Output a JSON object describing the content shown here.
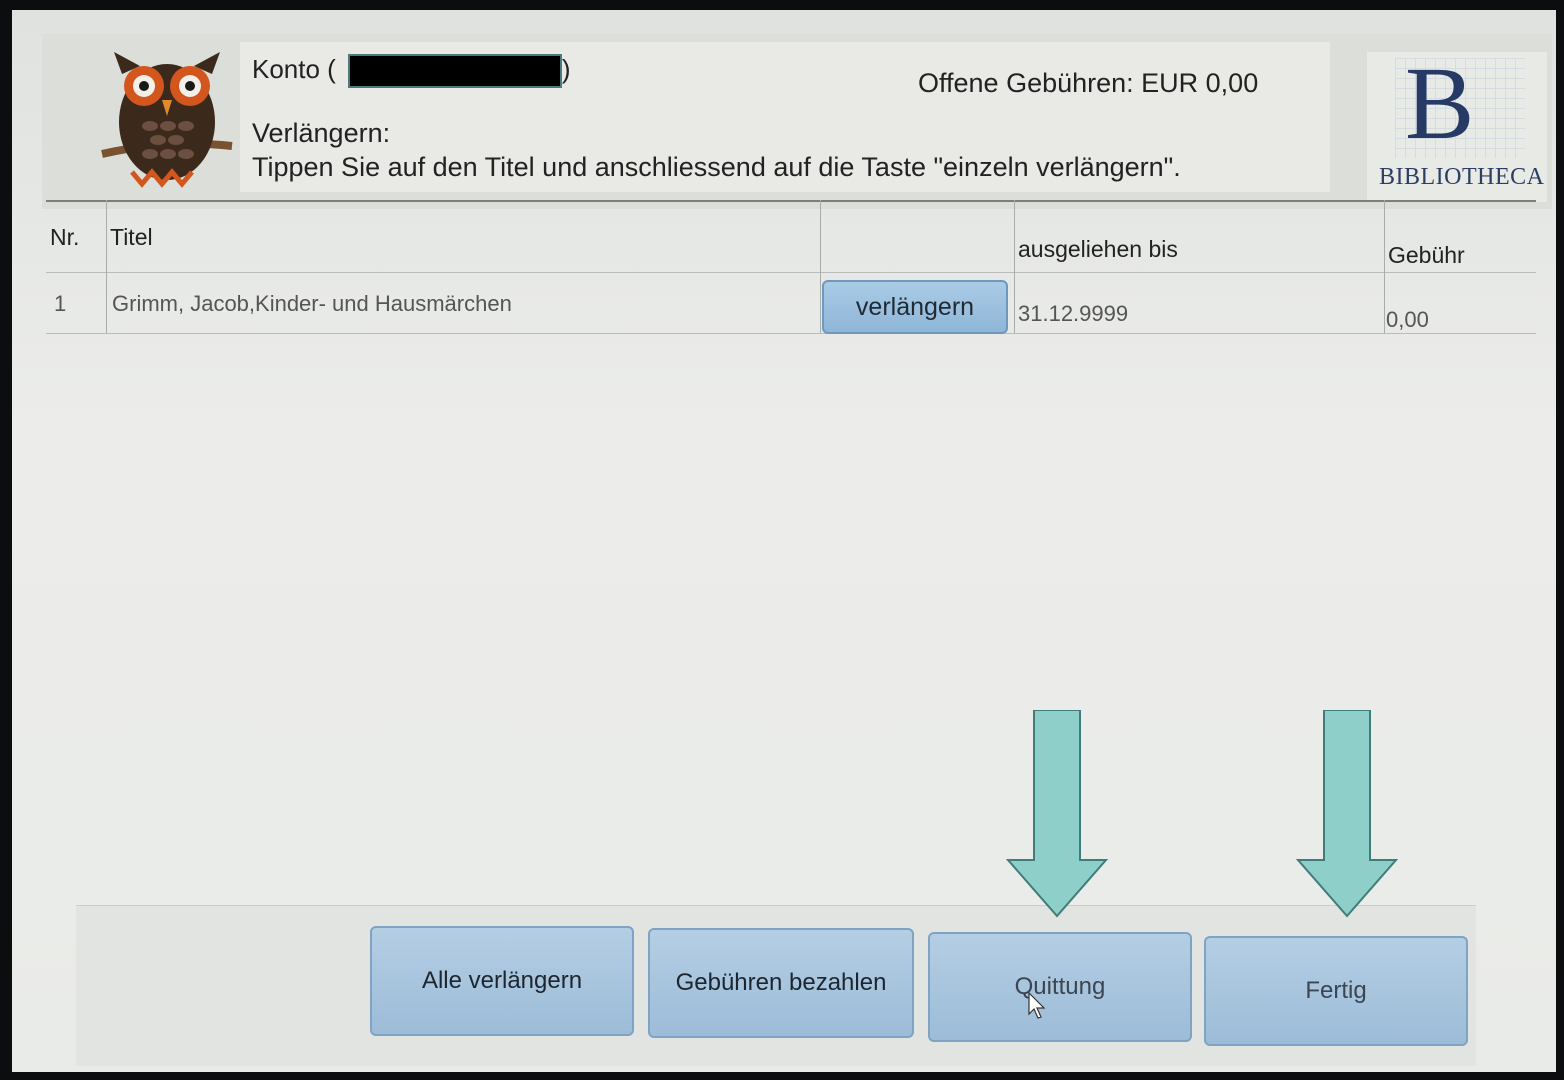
{
  "header": {
    "konto_label": "Konto (",
    "konto_suffix": ")",
    "fees": "Offene Gebühren: EUR 0,00",
    "renew_label": "Verlängern:",
    "instruction": "Tippen Sie auf den Titel und anschliessend auf die Taste \"einzeln verlängern\"."
  },
  "logo": {
    "letter": "B",
    "word": "BIBLIOTHECA"
  },
  "table": {
    "columns": [
      "Nr.",
      "Titel",
      "",
      "ausgeliehen bis",
      "Gebühr"
    ],
    "rows": [
      {
        "nr": "1",
        "title": "Grimm, Jacob,Kinder- und Hausmärchen",
        "action": "verlängern",
        "due": "31.12.9999",
        "fee": "0,00"
      }
    ]
  },
  "buttons": {
    "renew_all": "Alle verlängern",
    "pay_fees": "Gebühren bezahlen",
    "receipt": "Quittung",
    "done": "Fertig"
  },
  "colors": {
    "button": "#a9c6e0",
    "arrow": "#8fcfca",
    "owl": "#3b2a1c"
  }
}
